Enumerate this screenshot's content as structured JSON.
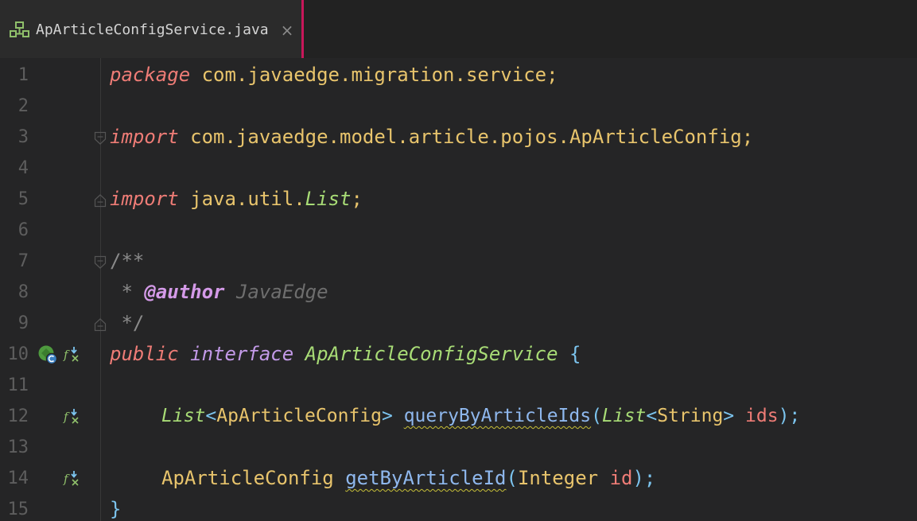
{
  "tab": {
    "title": "ApArticleConfigService.java",
    "close": "×",
    "icon": "interface-file-icon"
  },
  "colors": {
    "accent": "#c8175a",
    "background": "#252526",
    "keyword": "#ee7c76",
    "type": "#a8dc76",
    "class": "#e8c46c",
    "method": "#8fb8ee"
  },
  "lines": [
    {
      "num": "1",
      "t": [
        "package",
        "com.javaedge.migration.service;"
      ]
    },
    {
      "num": "2",
      "t": []
    },
    {
      "num": "3",
      "t": [
        "import",
        "com.javaedge.model.article.pojos.ApArticleConfig;"
      ]
    },
    {
      "num": "4",
      "t": []
    },
    {
      "num": "5",
      "t": [
        "import",
        "java.util.",
        "List",
        ";"
      ]
    },
    {
      "num": "6",
      "t": []
    },
    {
      "num": "7",
      "t": [
        "/**"
      ]
    },
    {
      "num": "8",
      "t": [
        "*",
        "@author",
        "JavaEdge"
      ]
    },
    {
      "num": "9",
      "t": [
        "*/"
      ]
    },
    {
      "num": "10",
      "t": [
        "public",
        "interface",
        "ApArticleConfigService",
        "{"
      ]
    },
    {
      "num": "11",
      "t": []
    },
    {
      "num": "12",
      "t": [
        "List",
        "<",
        "ApArticleConfig",
        ">",
        "queryByArticleIds",
        "(",
        "List",
        "<",
        "String",
        ">",
        "ids",
        ");"
      ]
    },
    {
      "num": "13",
      "t": []
    },
    {
      "num": "14",
      "t": [
        "ApArticleConfig",
        "getByArticleId",
        "(",
        "Integer",
        "id",
        ");"
      ]
    },
    {
      "num": "15",
      "t": [
        "}"
      ]
    }
  ],
  "gutter_icons": {
    "implemented": "implemented-interface-icon",
    "method": "method-implementations-icon"
  }
}
